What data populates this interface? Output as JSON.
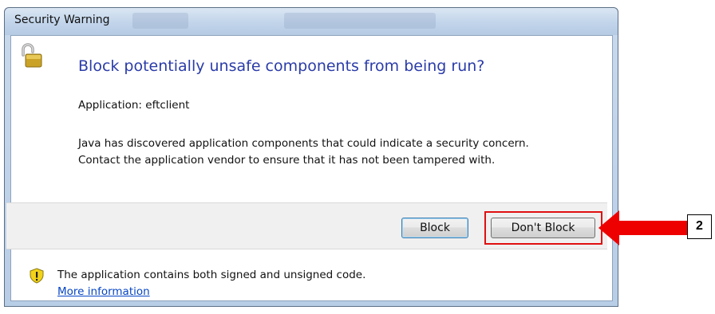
{
  "window": {
    "title": "Security Warning"
  },
  "dialog": {
    "headline": "Block potentially unsafe components from being run?",
    "application_line": "Application: eftclient",
    "description": "Java has discovered application components that could indicate a security concern. Contact the application vendor to ensure that it has not been tampered with.",
    "icon": "padlock-open-icon"
  },
  "buttons": {
    "block_label": "Block",
    "dont_block_label": "Don't Block"
  },
  "footer": {
    "icon": "shield-warning-icon",
    "text": "The application contains both signed and unsigned code.",
    "link": "More information"
  },
  "annotation": {
    "step_number": "2",
    "highlight_color": "#e01010"
  }
}
